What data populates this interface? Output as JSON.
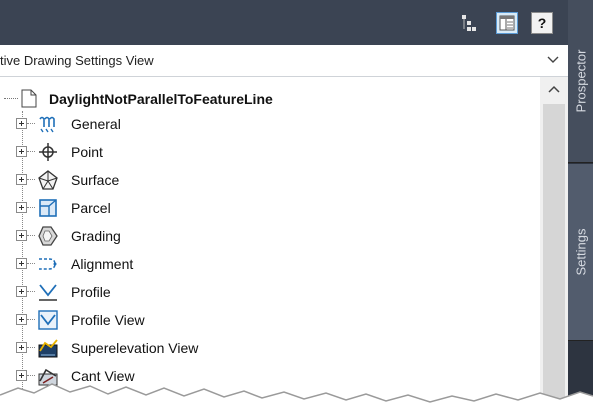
{
  "toolbar": {
    "icons": [
      "tree-structure-icon",
      "settings-view-icon",
      "help-icon"
    ],
    "help_label": "?"
  },
  "view_selector": {
    "value": "tive Drawing Settings View"
  },
  "tree": {
    "root_label": "DaylightNotParallelToFeatureLine",
    "items": [
      {
        "label": "General",
        "icon": "general-icon"
      },
      {
        "label": "Point",
        "icon": "point-icon"
      },
      {
        "label": "Surface",
        "icon": "surface-icon"
      },
      {
        "label": "Parcel",
        "icon": "parcel-icon"
      },
      {
        "label": "Grading",
        "icon": "grading-icon"
      },
      {
        "label": "Alignment",
        "icon": "alignment-icon"
      },
      {
        "label": "Profile",
        "icon": "profile-icon"
      },
      {
        "label": "Profile View",
        "icon": "profile-view-icon"
      },
      {
        "label": "Superelevation View",
        "icon": "superelevation-view-icon"
      },
      {
        "label": "Cant View",
        "icon": "cant-view-icon"
      }
    ]
  },
  "side_tabs": {
    "prospector": "Prospector",
    "settings": "Settings"
  },
  "colors": {
    "toolbar_bg": "#3b4453",
    "accent": "#5b9bd5",
    "icon_blue": "#1f6fb8"
  }
}
